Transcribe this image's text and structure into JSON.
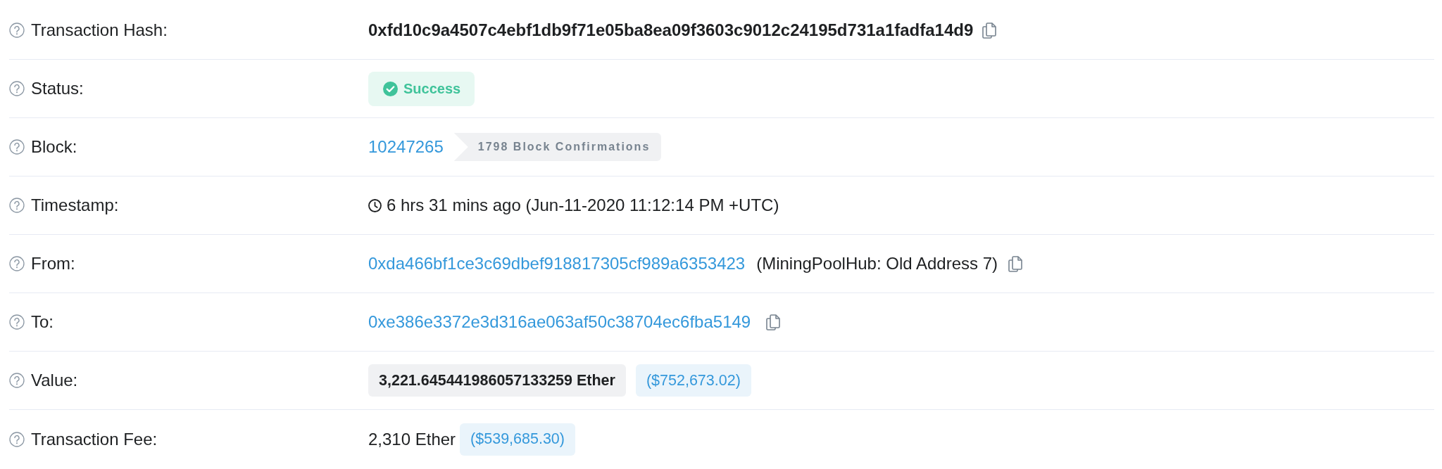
{
  "rows": [
    {
      "kind": "hash",
      "label": "Transaction Hash:",
      "value": "0xfd10c9a4507c4ebf1db9f71e05ba8ea09f3603c9012c24195d731a1fadfa14d9"
    },
    {
      "kind": "status",
      "label": "Status:",
      "status": "Success"
    },
    {
      "kind": "block",
      "label": "Block:",
      "block": "10247265",
      "confirmations": "1798 Block Confirmations"
    },
    {
      "kind": "timestamp",
      "label": "Timestamp:",
      "value": "6 hrs 31 mins ago (Jun-11-2020 11:12:14 PM +UTC)"
    },
    {
      "kind": "address",
      "label": "From:",
      "address": "0xda466bf1ce3c69dbef918817305cf989a6353423",
      "name": "(MiningPoolHub: Old Address 7)"
    },
    {
      "kind": "address",
      "label": "To:",
      "address": "0xe386e3372e3d316ae063af50c38704ec6fba5149"
    },
    {
      "kind": "value",
      "label": "Value:",
      "amount": "3,221.645441986057133259 Ether",
      "usd": "($752,673.02)"
    },
    {
      "kind": "fee",
      "label": "Transaction Fee:",
      "amount": "2,310 Ether",
      "usd": "($539,685.30)"
    }
  ]
}
